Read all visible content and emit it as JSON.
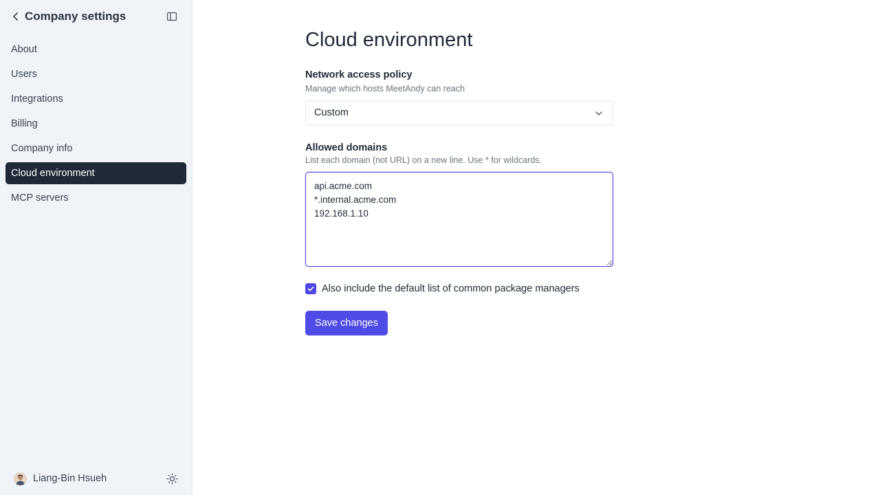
{
  "sidebar": {
    "title": "Company settings",
    "items": [
      {
        "label": "About"
      },
      {
        "label": "Users"
      },
      {
        "label": "Integrations"
      },
      {
        "label": "Billing"
      },
      {
        "label": "Company info"
      },
      {
        "label": "Cloud environment",
        "active": true
      },
      {
        "label": "MCP servers"
      }
    ],
    "user_name": "Liang-Bin Hsueh"
  },
  "main": {
    "title": "Cloud environment",
    "network": {
      "label": "Network access policy",
      "hint": "Manage which hosts MeetAndy can reach",
      "selected": "Custom"
    },
    "domains": {
      "label": "Allowed domains",
      "hint": "List each domain (not URL) on a new line. Use * for wildcards.",
      "value": "api.acme.com\n*.internal.acme.com\n192.168.1.10"
    },
    "checkbox": {
      "label": "Also include the default list of common package managers",
      "checked": true
    },
    "save_label": "Save changes"
  },
  "colors": {
    "accent": "#4f4be6",
    "sidebar_bg": "#f0f3f8",
    "active_item_bg": "#1f2937"
  },
  "icons": [
    "chevron-left-icon",
    "sidebar-toggle-icon",
    "chevron-down-icon",
    "check-icon",
    "sun-icon"
  ]
}
